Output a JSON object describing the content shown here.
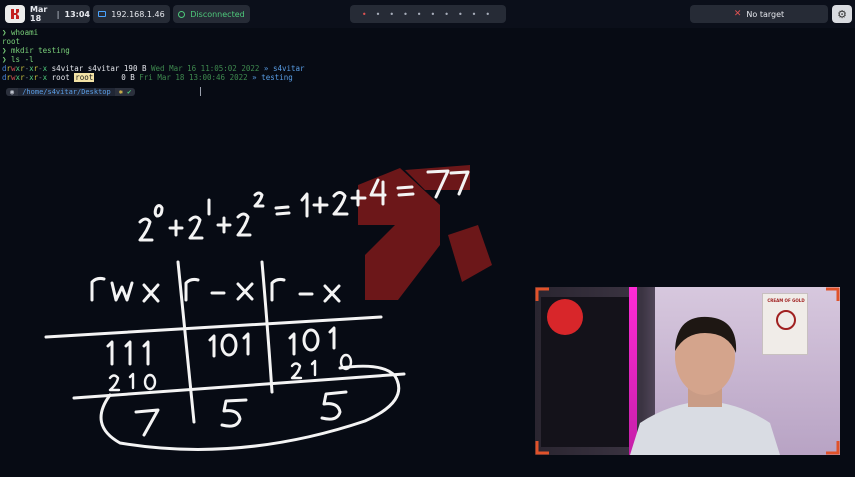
{
  "topbar": {
    "date": "Mar 18",
    "time": "13:04",
    "ip": "192.168.1.46",
    "vpn_status": "Disconnected",
    "workspaces": [
      "•",
      "•",
      "•",
      "•",
      "•",
      "•",
      "•",
      "•",
      "•",
      "•"
    ],
    "active_workspace_glyph": "•",
    "target": "No target",
    "icons": {
      "logo": "hack-logo-icon",
      "ip": "monitor-icon",
      "vpn": "disconnected-icon",
      "target": "no-target-x-icon",
      "settings": "settings-icon"
    }
  },
  "terminal": {
    "lines": [
      {
        "prompt": "❯",
        "text": "whoami"
      },
      {
        "output": "root"
      },
      {
        "prompt": "❯",
        "text": "mkdir testing"
      },
      {
        "prompt": "❯",
        "text": "ls -l"
      }
    ],
    "listing": [
      {
        "perms": "drwxr-xr-x",
        "user": "s4vitar",
        "group": "s4vitar",
        "size": "190 B",
        "date": "Wed Mar 16 11:05:02 2022",
        "arrow": "»",
        "name": "s4vitar"
      },
      {
        "perms": "drwxr-xr-x",
        "user": "root",
        "group": "root",
        "size": "0 B",
        "date": "Fri Mar 18 13:00:46 2022",
        "arrow": "»",
        "name": "testing"
      }
    ],
    "path_prompt": {
      "path": "/home/s4vitar/Desktop",
      "git_glyph": "✱",
      "status": "✔"
    }
  },
  "whiteboard": {
    "equation": "2⁰+2¹+2²=1+2+4=7",
    "headers": [
      "rwx",
      "r-x",
      "r-x"
    ],
    "binary": [
      "111",
      "101",
      "101"
    ],
    "bit_positions": [
      "210",
      "210"
    ],
    "octal": [
      "7",
      "5",
      "5"
    ]
  },
  "webcam": {
    "poster_title": "CREAM OF GOLD"
  },
  "colors": {
    "background": "#070b14",
    "accent_red": "#e05252",
    "prompt_green": "#7ad17a",
    "watermark": "#8b1c1c"
  }
}
